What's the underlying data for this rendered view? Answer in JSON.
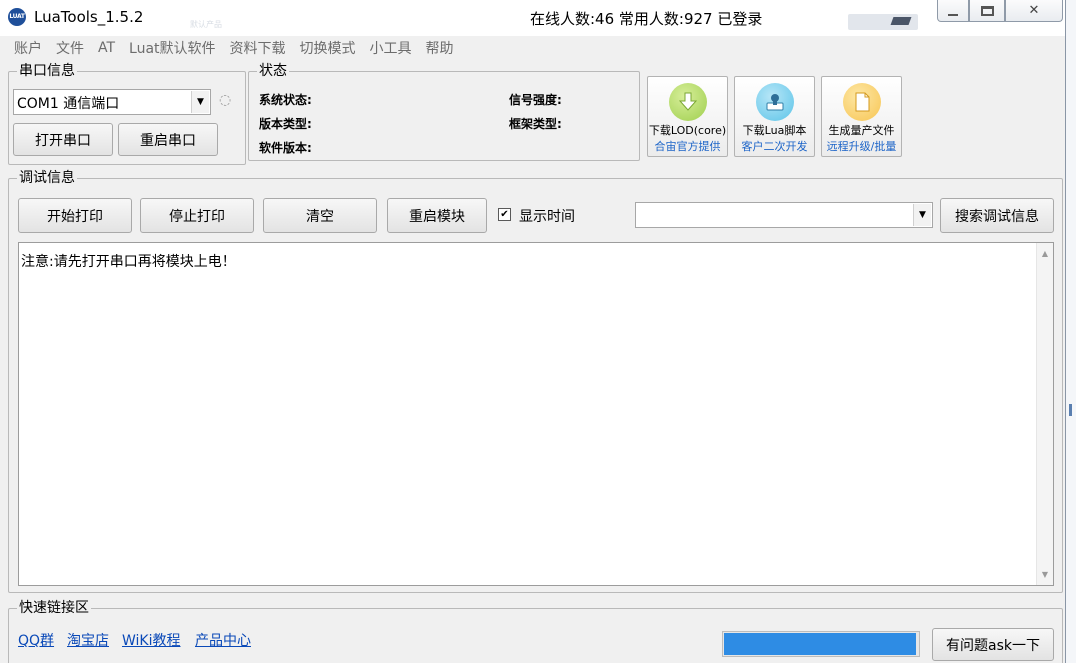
{
  "window": {
    "title": "LuaTools_1.5.2",
    "logo_text": "LUAT",
    "online_status": "在线人数:46 常用人数:927 已登录",
    "controls": {
      "minimize": "minimize-icon",
      "maximize": "maximize-icon",
      "close": "✕"
    }
  },
  "menu": [
    "账户",
    "文件",
    "AT",
    "Luat默认软件",
    "资料下载",
    "切换模式",
    "小工具",
    "帮助"
  ],
  "serial": {
    "group_label": "串口信息",
    "port_value": "COM1 通信端口",
    "indicator": "◌",
    "open_label": "打开串口",
    "restart_label": "重启串口"
  },
  "status": {
    "group_label": "状态",
    "system_state": "系统状态:",
    "signal_strength": "信号强度:",
    "version_type": "版本类型:",
    "frame_type": "框架类型:",
    "software_version": "软件版本:"
  },
  "downloads": [
    {
      "top": "下载LOD(core)",
      "bottom": "合宙官方提供",
      "icon": "download-arrow-icon",
      "color": "#9fcf4e"
    },
    {
      "top": "下载Lua脚本",
      "bottom": "客户二次开发",
      "icon": "script-upload-icon",
      "color": "#5cc4e8"
    },
    {
      "top": "生成量产文件",
      "bottom": "远程升级/批量",
      "icon": "document-icon",
      "color": "#f7c552"
    }
  ],
  "debug": {
    "group_label": "调试信息",
    "start_print": "开始打印",
    "stop_print": "停止打印",
    "clear": "清空",
    "restart_module": "重启模块",
    "show_time_label": "显示时间",
    "show_time_checked": true,
    "check_mark": "✔",
    "search_value": "",
    "search_button": "搜索调试信息",
    "log_text": "注意:请先打开串口再将模块上电！"
  },
  "quick_links": {
    "group_label": "快速链接区",
    "links": [
      "QQ群",
      "淘宝店",
      "WiKi教程",
      "产品中心"
    ],
    "progress_fraction": 0.99,
    "ask_button": "有问题ask一下"
  },
  "background": {
    "ghost_text": "默认产品"
  },
  "colors": {
    "progress": "#2e8ce4",
    "link": "#0a49b8",
    "sub_label": "#1c64c8"
  }
}
